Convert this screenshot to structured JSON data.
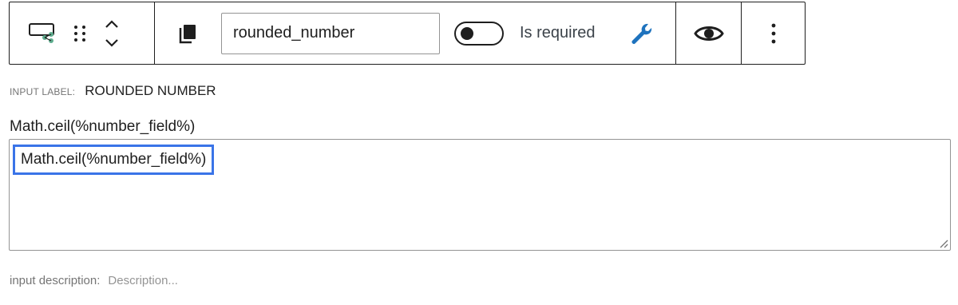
{
  "toolbar": {
    "block_icon": "calculated-field-icon",
    "drag_icon": "drag-handle-icon",
    "move_up_icon": "chevron-up-icon",
    "move_down_icon": "chevron-down-icon",
    "copy_icon": "copy-icon",
    "field_name": "rounded_number",
    "toggle_required_on": false,
    "required_label": "Is required",
    "settings_icon": "wrench-icon",
    "visibility_icon": "eye-icon",
    "more_icon": "more-vertical-icon",
    "accent_color": "#1e73be"
  },
  "label": {
    "key": "INPUT LABEL:",
    "value": "ROUNDED NUMBER"
  },
  "formula": {
    "title": "Math.ceil(%number_field%)",
    "value": "Math.ceil(%number_field%)",
    "highlight_color": "#3a74e8"
  },
  "description": {
    "key": "input description:",
    "placeholder": "Description..."
  }
}
